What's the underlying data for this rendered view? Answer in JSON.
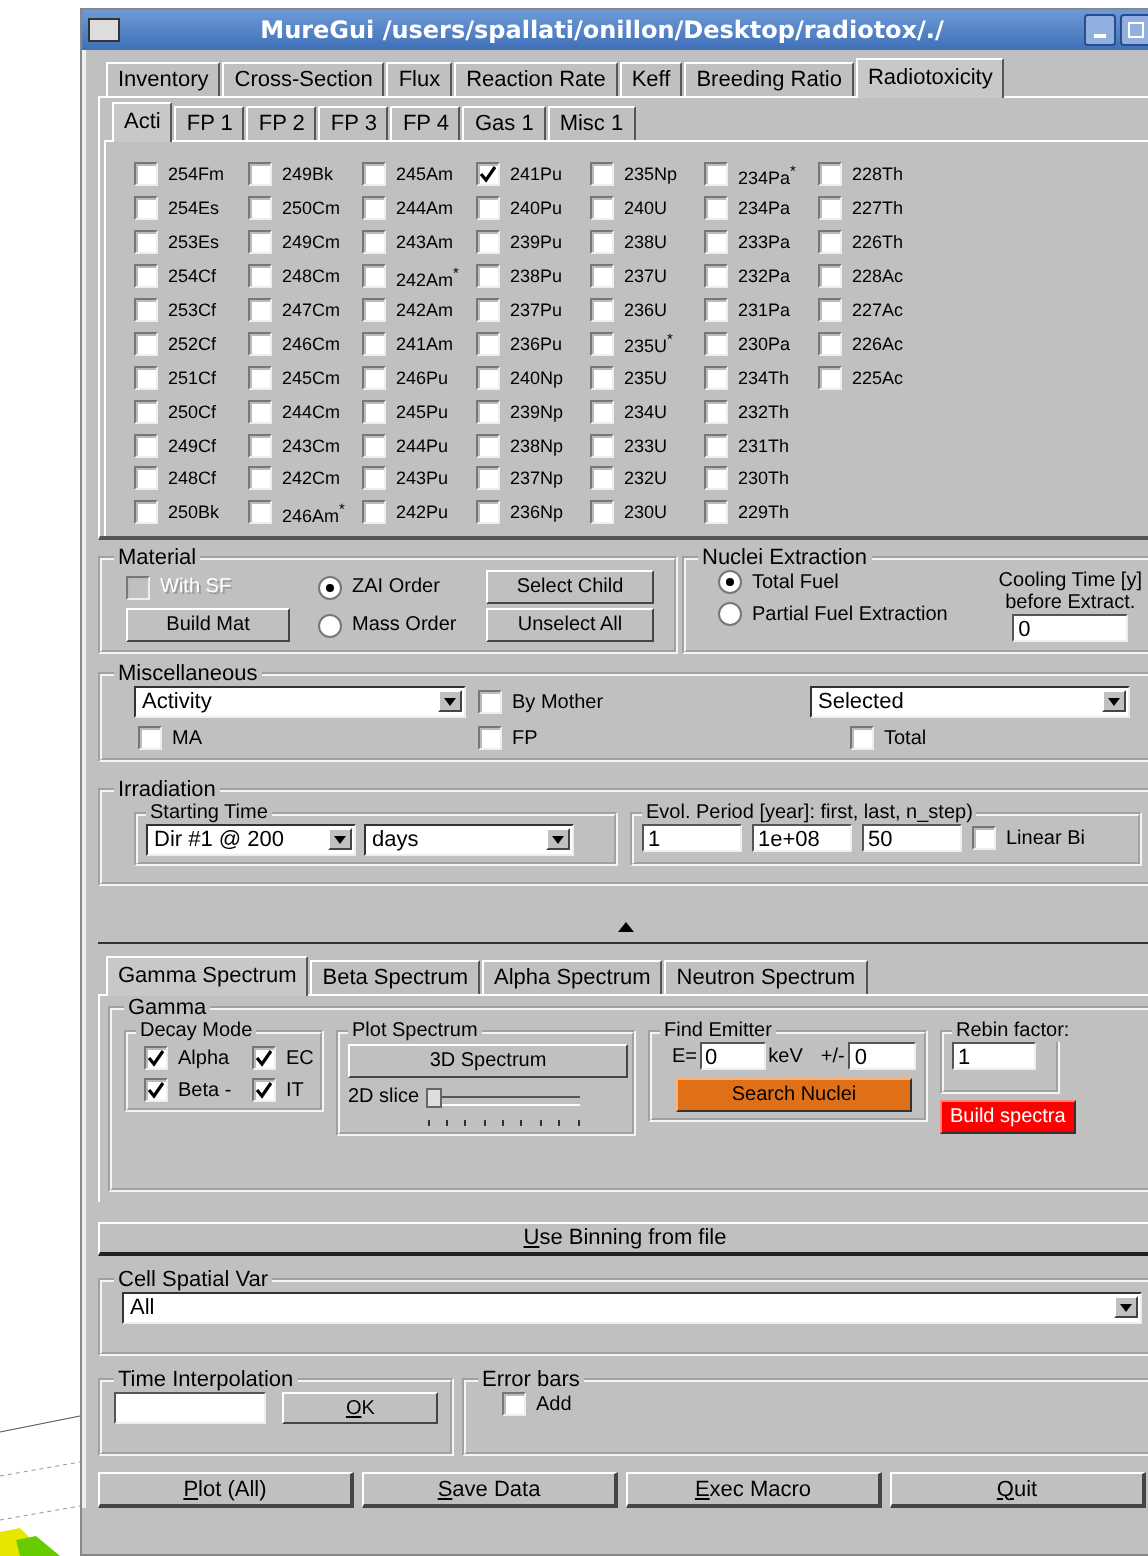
{
  "window": {
    "title": "MureGui /users/spallati/onillon/Desktop/radiotox/./"
  },
  "main_tabs": [
    {
      "label": "Inventory",
      "selected": false
    },
    {
      "label": "Cross-Section",
      "selected": false
    },
    {
      "label": "Flux",
      "selected": false
    },
    {
      "label": "Reaction Rate",
      "selected": false
    },
    {
      "label": "Keff",
      "selected": false
    },
    {
      "label": "Breeding Ratio",
      "selected": false
    },
    {
      "label": "Radiotoxicity",
      "selected": true
    }
  ],
  "sub_tabs": [
    {
      "label": "Acti",
      "selected": true
    },
    {
      "label": "FP 1",
      "selected": false
    },
    {
      "label": "FP 2",
      "selected": false
    },
    {
      "label": "FP 3",
      "selected": false
    },
    {
      "label": "FP 4",
      "selected": false
    },
    {
      "label": "Gas 1",
      "selected": false
    },
    {
      "label": "Misc 1",
      "selected": false
    }
  ],
  "nuclides": [
    {
      "label": "254Fm",
      "checked": false
    },
    {
      "label": "254Es",
      "checked": false
    },
    {
      "label": "253Es",
      "checked": false
    },
    {
      "label": "254Cf",
      "checked": false
    },
    {
      "label": "253Cf",
      "checked": false
    },
    {
      "label": "252Cf",
      "checked": false
    },
    {
      "label": "251Cf",
      "checked": false
    },
    {
      "label": "250Cf",
      "checked": false
    },
    {
      "label": "249Cf",
      "checked": false
    },
    {
      "label": "248Cf",
      "checked": false
    },
    {
      "label": "250Bk",
      "checked": false
    },
    {
      "label": "249Bk",
      "checked": false
    },
    {
      "label": "250Cm",
      "checked": false
    },
    {
      "label": "249Cm",
      "checked": false
    },
    {
      "label": "248Cm",
      "checked": false
    },
    {
      "label": "247Cm",
      "checked": false
    },
    {
      "label": "246Cm",
      "checked": false
    },
    {
      "label": "245Cm",
      "checked": false
    },
    {
      "label": "244Cm",
      "checked": false
    },
    {
      "label": "243Cm",
      "checked": false
    },
    {
      "label": "242Cm",
      "checked": false
    },
    {
      "label": "246Am$^{*}$",
      "checked": false
    },
    {
      "label": "245Am",
      "checked": false
    },
    {
      "label": "244Am",
      "checked": false
    },
    {
      "label": "243Am",
      "checked": false
    },
    {
      "label": "242Am$^{*}$",
      "checked": false
    },
    {
      "label": "242Am",
      "checked": false
    },
    {
      "label": "241Am",
      "checked": false
    },
    {
      "label": "246Pu",
      "checked": false
    },
    {
      "label": "245Pu",
      "checked": false
    },
    {
      "label": "244Pu",
      "checked": false
    },
    {
      "label": "243Pu",
      "checked": false
    },
    {
      "label": "242Pu",
      "checked": false
    },
    {
      "label": "241Pu",
      "checked": true
    },
    {
      "label": "240Pu",
      "checked": false
    },
    {
      "label": "239Pu",
      "checked": false
    },
    {
      "label": "238Pu",
      "checked": false
    },
    {
      "label": "237Pu",
      "checked": false
    },
    {
      "label": "236Pu",
      "checked": false
    },
    {
      "label": "240Np",
      "checked": false
    },
    {
      "label": "239Np",
      "checked": false
    },
    {
      "label": "238Np",
      "checked": false
    },
    {
      "label": "237Np",
      "checked": false
    },
    {
      "label": "236Np",
      "checked": false
    },
    {
      "label": "235Np",
      "checked": false
    },
    {
      "label": "240U",
      "checked": false
    },
    {
      "label": "238U",
      "checked": false
    },
    {
      "label": "237U",
      "checked": false
    },
    {
      "label": "236U",
      "checked": false
    },
    {
      "label": "235U$^{*}$",
      "checked": false
    },
    {
      "label": "235U",
      "checked": false
    },
    {
      "label": "234U",
      "checked": false
    },
    {
      "label": "233U",
      "checked": false
    },
    {
      "label": "232U",
      "checked": false
    },
    {
      "label": "230U",
      "checked": false
    },
    {
      "label": "234Pa$^{*}$",
      "checked": false
    },
    {
      "label": "234Pa",
      "checked": false
    },
    {
      "label": "233Pa",
      "checked": false
    },
    {
      "label": "232Pa",
      "checked": false
    },
    {
      "label": "231Pa",
      "checked": false
    },
    {
      "label": "230Pa",
      "checked": false
    },
    {
      "label": "234Th",
      "checked": false
    },
    {
      "label": "232Th",
      "checked": false
    },
    {
      "label": "231Th",
      "checked": false
    },
    {
      "label": "230Th",
      "checked": false
    },
    {
      "label": "229Th",
      "checked": false
    },
    {
      "label": "228Th",
      "checked": false
    },
    {
      "label": "227Th",
      "checked": false
    },
    {
      "label": "226Th",
      "checked": false
    },
    {
      "label": "228Ac",
      "checked": false
    },
    {
      "label": "227Ac",
      "checked": false
    },
    {
      "label": "226Ac",
      "checked": false
    },
    {
      "label": "225Ac",
      "checked": false
    }
  ],
  "material": {
    "title": "Material",
    "with_sf": {
      "label": "With SF",
      "checked": false,
      "disabled": true
    },
    "order": [
      {
        "label": "ZAI Order",
        "selected": true
      },
      {
        "label": "Mass Order",
        "selected": false
      }
    ],
    "build_button": "Build Mat",
    "select_child_button": "Select Child",
    "unselect_button": "Unselect All"
  },
  "nuclei_extraction": {
    "title": "Nuclei Extraction",
    "options": [
      {
        "label": "Total Fuel",
        "selected": true
      },
      {
        "label": "Partial Fuel Extraction",
        "selected": false
      }
    ],
    "cooling_label": [
      "Cooling Time [y]",
      "before Extract."
    ],
    "cooling_value": "0"
  },
  "miscellaneous": {
    "title": "Miscellaneous",
    "quantity": "Activity",
    "by_mother": {
      "label": "By Mother",
      "checked": false
    },
    "ma": {
      "label": "MA",
      "checked": false
    },
    "fp": {
      "label": "FP",
      "checked": false
    },
    "selection": "Selected",
    "total": {
      "label": "Total",
      "checked": false
    }
  },
  "irradiation": {
    "title": "Irradiation",
    "starting_time": {
      "title": "Starting Time",
      "dir": "Dir #1 @ 200",
      "unit": "days"
    },
    "evol_period": {
      "title": "Evol. Period [year]: first, last, n_step)",
      "first": "1",
      "last": "1e+08",
      "n_step": "50",
      "linear": {
        "label": "Linear Bi",
        "checked": false
      }
    }
  },
  "spectrum_tabs": [
    {
      "label": "Gamma Spectrum",
      "selected": true
    },
    {
      "label": "Beta Spectrum",
      "selected": false
    },
    {
      "label": "Alpha Spectrum",
      "selected": false
    },
    {
      "label": "Neutron Spectrum",
      "selected": false
    }
  ],
  "gamma": {
    "title": "Gamma",
    "decay_mode": {
      "title": "Decay Mode",
      "modes": [
        {
          "label": "Alpha",
          "checked": true
        },
        {
          "label": "EC",
          "checked": true
        },
        {
          "label": "Beta -",
          "checked": true
        },
        {
          "label": "IT",
          "checked": true
        }
      ]
    },
    "plot_spectrum": {
      "title": "Plot Spectrum",
      "button": "3D Spectrum",
      "slice_label": "2D slice",
      "level": 0
    },
    "find_emitter": {
      "title": "Find Emitter",
      "e_label": "E=",
      "e_value": "0",
      "unit": "keV",
      "tol_label": "+/-",
      "tol_value": "0",
      "button": "Search Nuclei"
    },
    "rebin": {
      "title": "Rebin factor:",
      "value": "1"
    },
    "build_button": "Build spectra"
  },
  "binning_button": "Use Binning from file",
  "cell_spatial_var": {
    "title": "Cell Spatial Var",
    "value": "All"
  },
  "time_interpolation": {
    "title": "Time Interpolation",
    "button": "OK"
  },
  "error_bars": {
    "title": "Error bars",
    "add": {
      "label": "Add",
      "checked": false
    }
  },
  "bottom_buttons": [
    "Plot (All)",
    "Save Data",
    "Exec Macro",
    "Quit"
  ]
}
